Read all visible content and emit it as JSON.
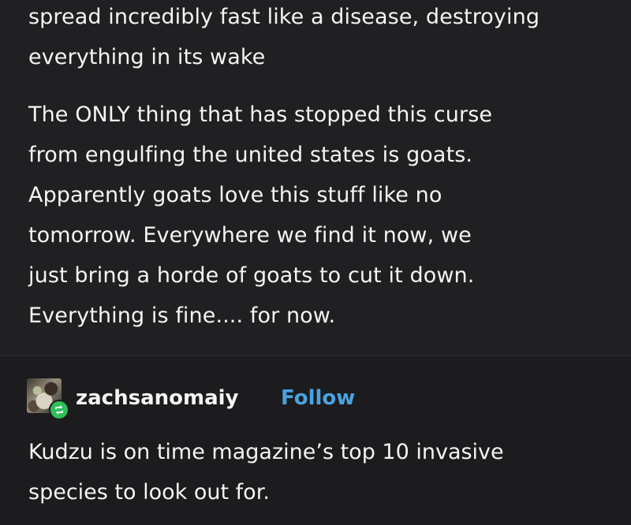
{
  "post": {
    "paragraphs": [
      [
        "spread incredibly fast like a disease, destroying",
        "everything in its wake"
      ],
      [
        "The ONLY thing that has stopped this curse",
        "from engulfing the united states is goats.",
        "Apparently goats love this stuff like no",
        "tomorrow. Everywhere we find it now, we",
        "just bring a horde of goats to cut it down.",
        "Everything is fine.... for now."
      ]
    ]
  },
  "reply": {
    "username": "zachsanomaiy",
    "follow_label": "Follow",
    "text_lines": [
      "Kudzu is on time magazine’s top 10 invasive",
      "species to look out for."
    ]
  },
  "colors": {
    "background": "#1c1c1e",
    "text": "#f4f4f4",
    "follow_link": "#4aa3e0",
    "reblog_badge": "#2fbf5b"
  },
  "icons": {
    "badge": "reblog-icon"
  }
}
